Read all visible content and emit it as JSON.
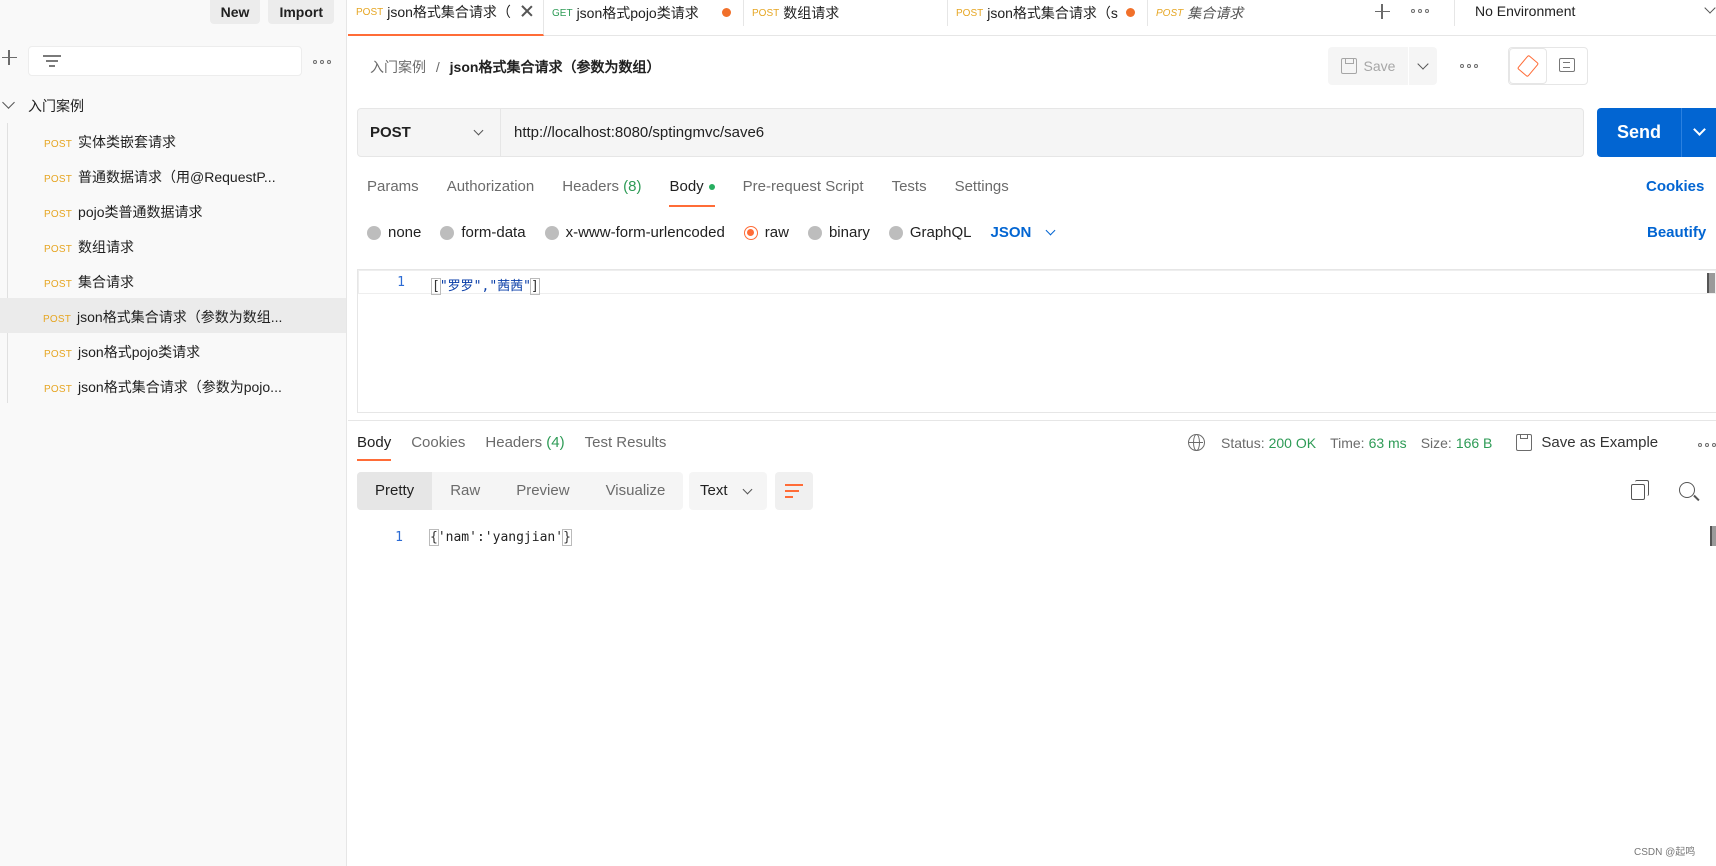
{
  "sidebar": {
    "new_label": "New",
    "import_label": "Import",
    "folder": {
      "label": "入门案例"
    },
    "items": [
      {
        "method": "POST",
        "name": "实体类嵌套请求"
      },
      {
        "method": "POST",
        "name": "普通数据请求（用@RequestP..."
      },
      {
        "method": "POST",
        "name": "pojo类普通数据请求"
      },
      {
        "method": "POST",
        "name": "数组请求"
      },
      {
        "method": "POST",
        "name": "集合请求"
      },
      {
        "method": "POST",
        "name": "json格式集合请求（参数为数组..."
      },
      {
        "method": "POST",
        "name": "json格式pojo类请求"
      },
      {
        "method": "POST",
        "name": "json格式集合请求（参数为pojo..."
      }
    ]
  },
  "tabs": [
    {
      "method": "POST",
      "title": "json格式集合请求（"
    },
    {
      "method": "GET",
      "title": "json格式pojo类请求"
    },
    {
      "method": "POST",
      "title": "数组请求"
    },
    {
      "method": "POST",
      "title": "json格式集合请求（s"
    },
    {
      "method": "POST",
      "title": "集合请求"
    }
  ],
  "environment": "No Environment",
  "breadcrumb": {
    "parent": "入门案例",
    "separator": "/",
    "current": "json格式集合请求（参数为数组）"
  },
  "save_label": "Save",
  "request": {
    "method": "POST",
    "url": "http://localhost:8080/sptingmvc/save6",
    "send_label": "Send",
    "tabs": {
      "params": "Params",
      "authorization": "Authorization",
      "headers": "Headers",
      "headers_count": "(8)",
      "body": "Body",
      "prerequest": "Pre-request Script",
      "tests": "Tests",
      "settings": "Settings"
    },
    "cookies_label": "Cookies",
    "body_types": {
      "none": "none",
      "form_data": "form-data",
      "urlencoded": "x-www-form-urlencoded",
      "raw": "raw",
      "binary": "binary",
      "graphql": "GraphQL"
    },
    "raw_format": "JSON",
    "beautify_label": "Beautify",
    "body_line_no": "1",
    "body": {
      "open": "[",
      "item1": "\"罗罗\"",
      "comma": ",",
      "item2": "\"茜茜\"",
      "close": "]"
    }
  },
  "response": {
    "tabs": {
      "body": "Body",
      "cookies": "Cookies",
      "headers": "Headers",
      "headers_count": "(4)",
      "test_results": "Test Results"
    },
    "status_key": "Status:",
    "status_value": "200 OK",
    "time_key": "Time:",
    "time_value": "63 ms",
    "size_key": "Size:",
    "size_value": "166 B",
    "save_example": "Save as Example",
    "formats": {
      "pretty": "Pretty",
      "raw": "Raw",
      "preview": "Preview",
      "visualize": "Visualize"
    },
    "text_type": "Text",
    "line_no": "1",
    "body": {
      "open": "{",
      "content": "'nam':'yangjian'",
      "close": "}"
    }
  },
  "watermark": "CSDN @起鸣",
  "colors": {
    "accent": "#ff6c37",
    "send": "#0265d2",
    "post": "#e6a623",
    "get": "#2e9b56",
    "status_ok": "#2e9b56"
  }
}
